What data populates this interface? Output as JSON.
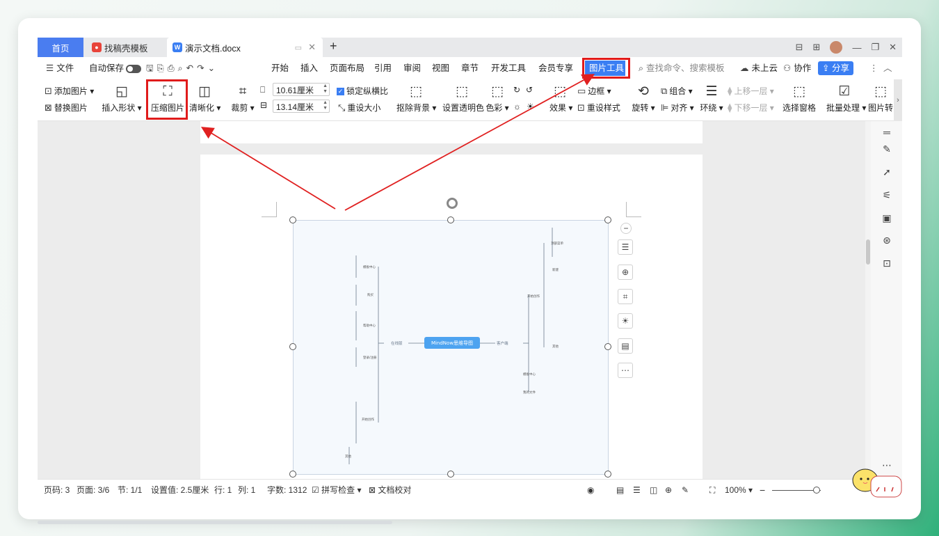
{
  "tabs": {
    "home": "首页",
    "template": "找稿壳模板",
    "document": "演示文档.docx",
    "new_tab": "+"
  },
  "menu": {
    "file": "文件",
    "autosave": "自动保存",
    "items": [
      "开始",
      "插入",
      "页面布局",
      "引用",
      "审阅",
      "视图",
      "章节",
      "开发工具",
      "会员专享"
    ],
    "picture_tools": "图片工具",
    "search_placeholder": "查找命令、搜索模板",
    "cloud": "未上云",
    "collaborate": "协作",
    "share": "分享"
  },
  "ribbon": {
    "add_picture": "添加图片",
    "replace_picture": "替换图片",
    "insert_shape": "插入形状",
    "compress_picture": "压缩图片",
    "sharpen": "清晰化",
    "crop": "裁剪",
    "width_value": "10.61厘米",
    "height_value": "13.14厘米",
    "lock_ratio": "锁定纵横比",
    "reset_size": "重设大小",
    "remove_bg": "抠除背景",
    "set_transparent": "设置透明色",
    "color": "色彩",
    "border": "边框",
    "effects": "效果",
    "reset_style": "重设样式",
    "rotate": "旋转",
    "group": "组合",
    "align": "对齐",
    "wrap": "环绕",
    "bring_forward": "上移一层",
    "send_backward": "下移一层",
    "selection_pane": "选择窗格",
    "batch": "批量处理",
    "picture_more": "图片转"
  },
  "mindmap": {
    "center": "MindNow思维导图",
    "left_branch": "在线版",
    "right_branch": "客户端"
  },
  "status": {
    "page_no": "页码: 3",
    "page": "页面: 3/6",
    "section": "节: 1/1",
    "setting": "设置值: 2.5厘米",
    "row": "行: 1",
    "col": "列: 1",
    "words": "字数: 1312",
    "spell": "拼写检查",
    "proofread": "文档校对",
    "zoom": "100%"
  },
  "colors": {
    "accent": "#3a7ef3",
    "highlight_box": "#e01b1b",
    "arrow": "#e02020"
  }
}
